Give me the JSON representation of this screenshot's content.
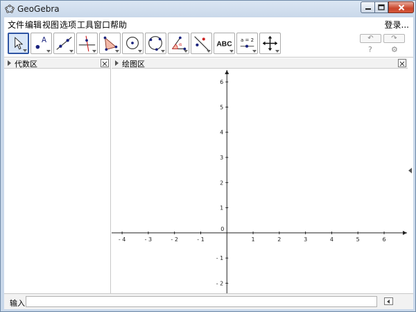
{
  "window": {
    "title": "GeoGebra"
  },
  "menu": {
    "items": [
      "文件",
      "编辑",
      "视图",
      "选项",
      "工具",
      "窗口",
      "帮助"
    ],
    "login": "登录..."
  },
  "toolbar": {
    "text_tool_label": "ABC",
    "slider_tool_label": "a = 2",
    "tools": [
      "move",
      "point",
      "line",
      "perpendicular-line",
      "polygon",
      "circle-center-point",
      "conic-five-points",
      "angle",
      "reflect-about-line",
      "text",
      "slider",
      "move-graphics-view"
    ]
  },
  "algebra_view": {
    "title": "代数区"
  },
  "graphics_view": {
    "title": "绘图区",
    "origin_label": "0"
  },
  "input_bar": {
    "label": "输入:",
    "value": "",
    "placeholder": ""
  },
  "colors": {
    "selected_tool_border": "#2f55a4",
    "point": "#1a237e",
    "accent_red": "#cc2222"
  },
  "chart_data": {
    "type": "line",
    "x_ticks": [
      -4,
      -3,
      -2,
      -1,
      1,
      2,
      3,
      4,
      5,
      6
    ],
    "y_ticks": [
      -2,
      -1,
      1,
      2,
      3,
      4,
      5,
      6
    ],
    "xlim": [
      -4.4,
      6.9
    ],
    "ylim": [
      -2.4,
      6.5
    ],
    "grid": false
  }
}
